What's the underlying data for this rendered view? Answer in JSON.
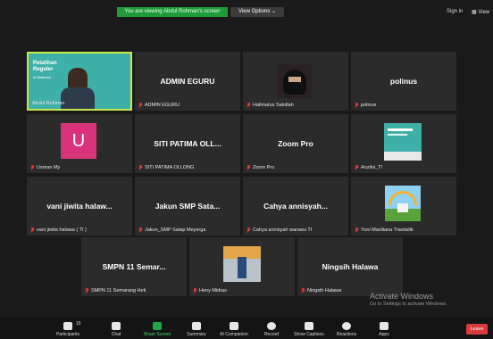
{
  "banner": "You are viewing Abdul Rohman's screen",
  "view_options": "View Options",
  "top_right": {
    "sign_in": "Sign in",
    "view": "View"
  },
  "tiles": [
    {
      "name": "",
      "label": "Abdul Rohman"
    },
    {
      "name": "ADMIN EGURU",
      "label": "ADMIN EGURU"
    },
    {
      "name": "",
      "label": "Halimatus Sakdiah"
    },
    {
      "name": "polinus",
      "label": "polinus"
    },
    {
      "name": "",
      "label": "Usman My",
      "avatar": "U"
    },
    {
      "name": "SITI PATIMA OLL...",
      "label": "SITI PATIMA OLLONG"
    },
    {
      "name": "Zoom Pro",
      "label": "Zoom Pro"
    },
    {
      "name": "",
      "label": "Anzilni_T!"
    },
    {
      "name": "vani jiwita halaw...",
      "label": "vani jiwita halawa ( TI )"
    },
    {
      "name": "Jakun SMP Sata...",
      "label": "Jakun_SMP Satap Meyerga"
    },
    {
      "name": "Cahya annisyah...",
      "label": "Cahya annisyah warawu TI"
    },
    {
      "name": "",
      "label": "Yuni Mardiana Triastatik"
    },
    {
      "name": "SMPN 11 Semar...",
      "label": "SMPN 11 Semarang Heti"
    },
    {
      "name": "",
      "label": "Heny Midras"
    },
    {
      "name": "Ningsih Halawa",
      "label": "Ningsih Halawa"
    }
  ],
  "slide": {
    "title": "Pelatihan Reguler",
    "sub": "di Mataram"
  },
  "toolbar": {
    "participants": "Participants",
    "participants_count": "15",
    "chat": "Chat",
    "share": "Share Screen",
    "summary": "Summary",
    "ai": "AI Companion",
    "record": "Record",
    "captions": "Show Captions",
    "reactions": "Reactions",
    "apps": "Apps",
    "leave": "Leave"
  },
  "watermark": {
    "line1": "Activate Windows",
    "line2": "Go to Settings to activate Windows."
  }
}
